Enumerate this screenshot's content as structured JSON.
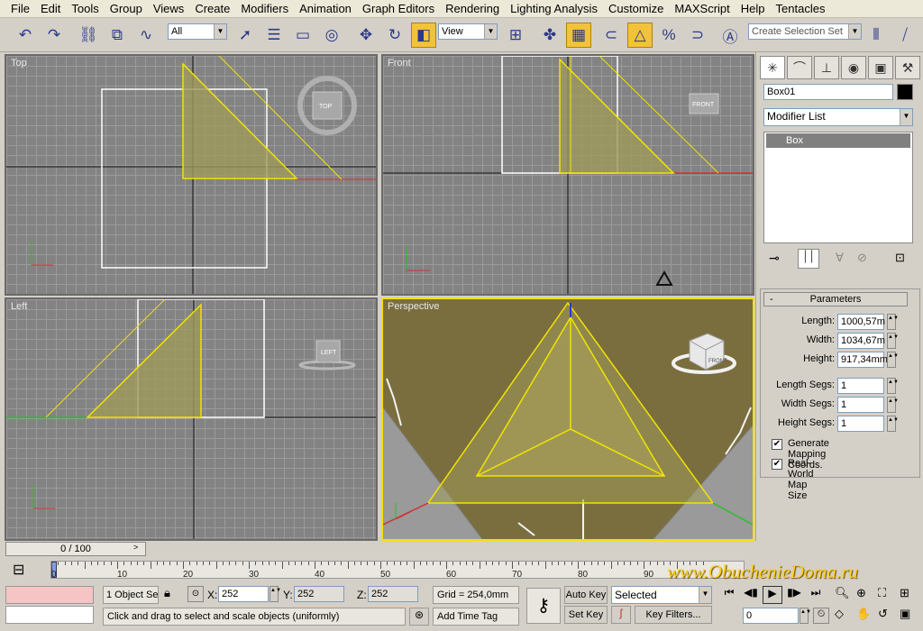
{
  "menu": [
    "File",
    "Edit",
    "Tools",
    "Group",
    "Views",
    "Create",
    "Modifiers",
    "Animation",
    "Graph Editors",
    "Rendering",
    "Lighting Analysis",
    "Customize",
    "MAXScript",
    "Help",
    "Tentacles"
  ],
  "toolbar": {
    "filter_value": "All",
    "coord_system": "View",
    "selection_set_placeholder": "Create Selection Set"
  },
  "viewports": [
    {
      "label": "Top",
      "cube_text": "TOP"
    },
    {
      "label": "Front",
      "cube_text": "FRONT"
    },
    {
      "label": "Left",
      "cube_text": "LEFT"
    },
    {
      "label": "Perspective",
      "cube_text": "FRONT"
    }
  ],
  "command_panel": {
    "object_name": "Box01",
    "modifier_list": "Modifier List",
    "stack_item": "Box",
    "rollout_title": "Parameters",
    "params": [
      {
        "label": "Length:",
        "value": "1000,57m"
      },
      {
        "label": "Width:",
        "value": "1034,67m"
      },
      {
        "label": "Height:",
        "value": "917,34mm"
      },
      {
        "label": "Length Segs:",
        "value": "1"
      },
      {
        "label": "Width Segs:",
        "value": "1"
      },
      {
        "label": "Height Segs:",
        "value": "1"
      }
    ],
    "checks": [
      {
        "label": "Generate Mapping Coords.",
        "checked": true
      },
      {
        "label": "Real-World Map Size",
        "checked": true
      }
    ]
  },
  "status": {
    "time_slider": "0 / 100",
    "selection_count": "1 Object Se",
    "x_label": "X:",
    "x": "252",
    "y_label": "Y:",
    "y": "252",
    "z_label": "Z:",
    "z": "252",
    "grid": "Grid = 254,0mm",
    "prompt": "Click and drag to select and scale objects (uniformly)",
    "add_time_tag": "Add Time Tag",
    "auto_key": "Auto Key",
    "set_key": "Set Key",
    "key_mode": "Selected",
    "key_filters": "Key Filters...",
    "frame": "0"
  },
  "timeline_ticks": [
    "0",
    "10",
    "20",
    "30",
    "40",
    "50",
    "60",
    "70",
    "80",
    "90"
  ],
  "watermark": "www.ObuchenieDoma.ru",
  "colors": {
    "selection": "#f4e000",
    "viewport_bg": "#838383",
    "panel_bg": "#d4d0c8",
    "active_tool": "#f2c23a"
  }
}
